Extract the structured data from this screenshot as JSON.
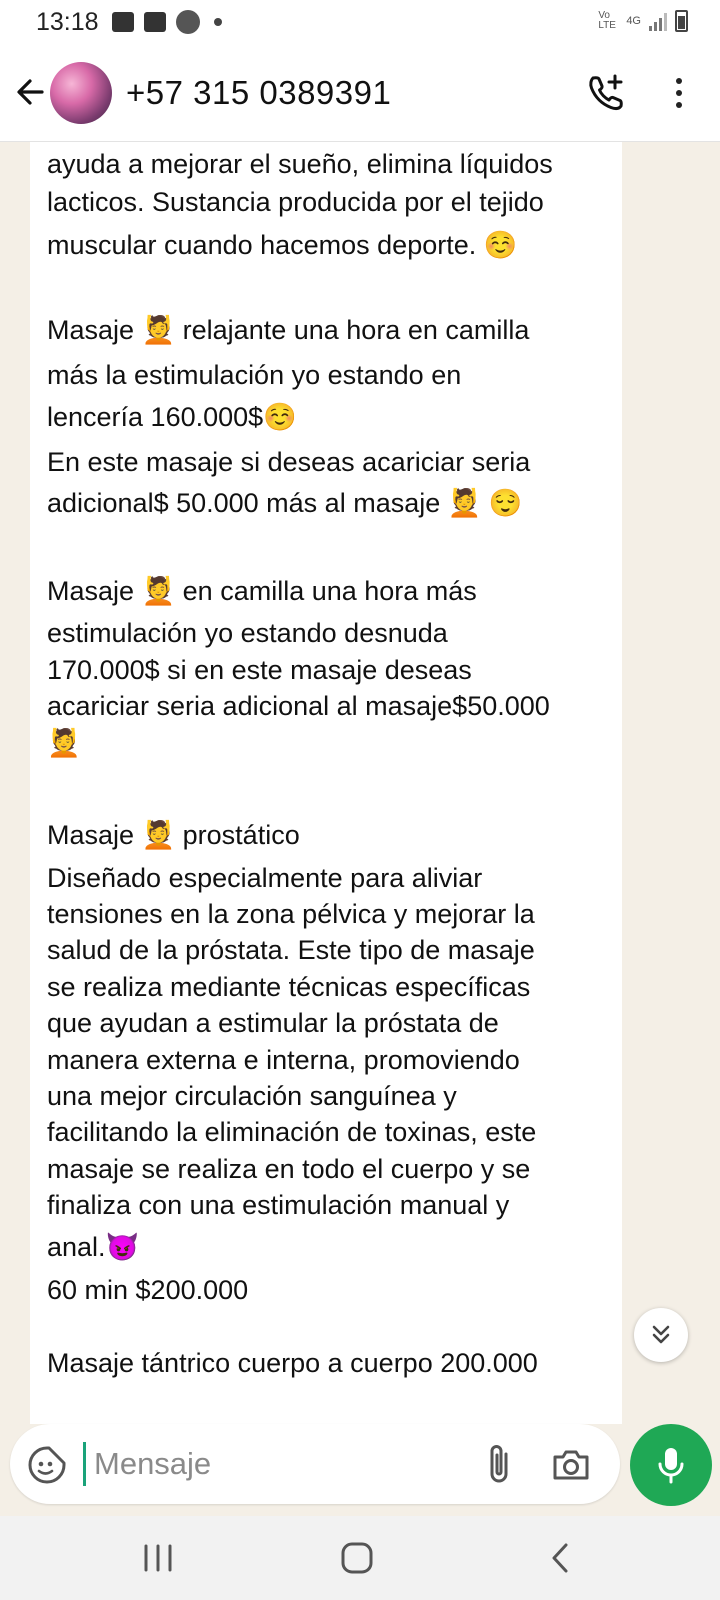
{
  "status_bar": {
    "time": "13:18",
    "network_label": "Vo LTE",
    "network_type": "4G"
  },
  "header": {
    "contact_name": "+57 315 0389391",
    "icons": [
      "back-arrow-icon",
      "add-call-icon",
      "more-vert-icon"
    ]
  },
  "message": {
    "lines": [
      "ayuda a mejorar el sueño, elimina líquidos",
      "lacticos. Sustancia producida por el tejido",
      "muscular cuando hacemos deporte. ☺️",
      "",
      "Masaje 💆 relajante una hora en camilla",
      "más la estimulación yo estando en",
      "lencería 160.000$☺️",
      "En este masaje si deseas acariciar seria",
      "adicional$ 50.000 más al masaje 💆 😌",
      "",
      "Masaje 💆 en camilla una hora más",
      "estimulación yo estando desnuda",
      "170.000$ si en este masaje deseas",
      "acariciar seria adicional al masaje$50.000",
      "💆",
      "",
      "Masaje 💆 prostático",
      "Diseñado especialmente para aliviar",
      "tensiones en la zona pélvica y mejorar la",
      "salud de la próstata. Este tipo de masaje",
      "se realiza mediante técnicas específicas",
      "que ayudan a estimular la próstata de",
      "manera externa e interna, promoviendo",
      "una mejor circulación sanguínea y",
      "facilitando la eliminación de toxinas, este",
      "masaje se realiza en todo el cuerpo y se",
      "finaliza con una estimulación manual y",
      "anal.😈",
      "60 min $200.000",
      "",
      "Masaje tántrico cuerpo a cuerpo 200.000"
    ]
  },
  "composer": {
    "placeholder": "Mensaje",
    "icons": [
      "sticker-icon",
      "attach-icon",
      "camera-icon",
      "mic-icon"
    ]
  },
  "scroll_down_icon": "double-chevron-down-icon",
  "navbar": {
    "icons": [
      "recents-icon",
      "home-icon",
      "back-icon"
    ]
  },
  "colors": {
    "accent_green": "#1fa855",
    "chat_background": "#f4efe6",
    "bubble": "#ffffff"
  }
}
